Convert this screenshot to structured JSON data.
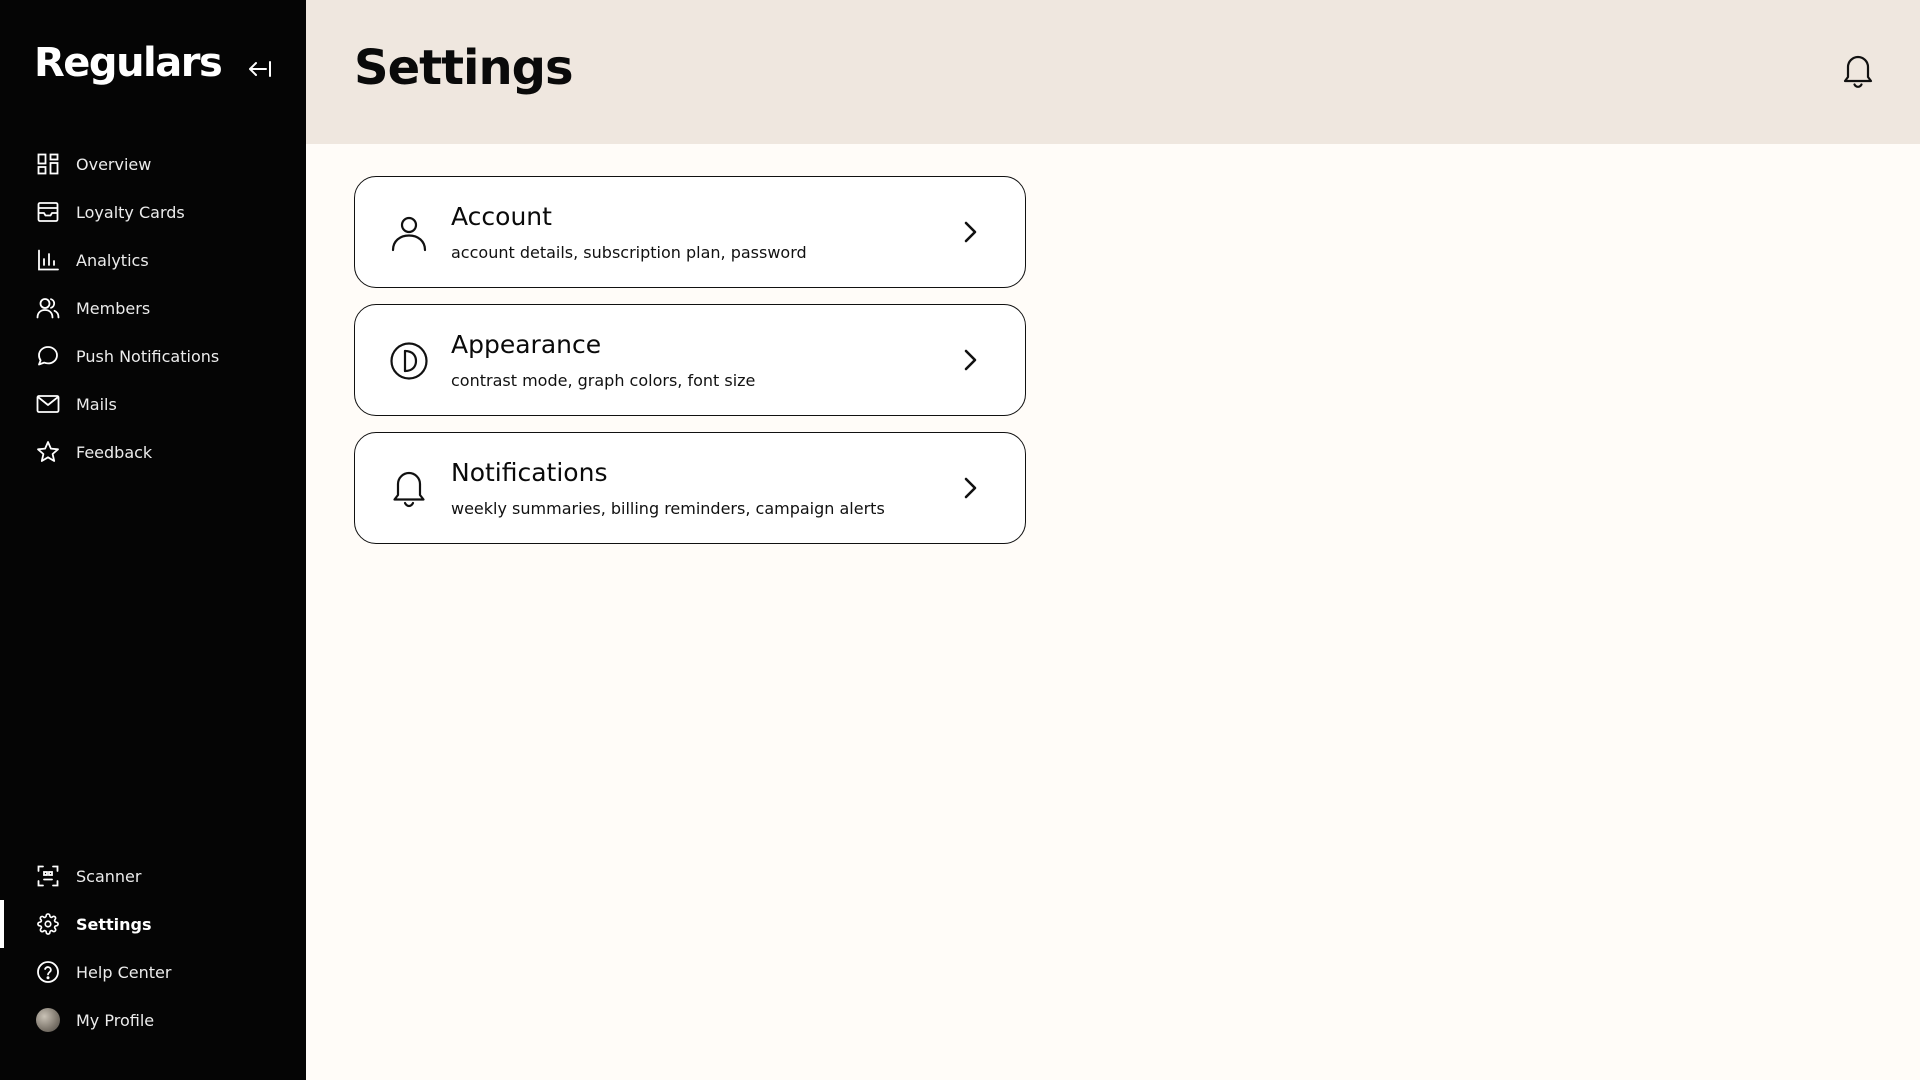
{
  "app": {
    "brand": "Regulars"
  },
  "sidebar": {
    "top_items": [
      {
        "label": "Overview",
        "icon": "overview-icon"
      },
      {
        "label": "Loyalty Cards",
        "icon": "loyalty-cards-icon"
      },
      {
        "label": "Analytics",
        "icon": "analytics-icon"
      },
      {
        "label": "Members",
        "icon": "members-icon"
      },
      {
        "label": "Push Notifications",
        "icon": "chat-bubble-icon"
      },
      {
        "label": "Mails",
        "icon": "mail-icon"
      },
      {
        "label": "Feedback",
        "icon": "star-icon"
      }
    ],
    "bottom_items": [
      {
        "label": "Scanner",
        "icon": "scanner-icon"
      },
      {
        "label": "Settings",
        "icon": "gear-icon",
        "active": true
      },
      {
        "label": "Help Center",
        "icon": "help-icon"
      },
      {
        "label": "My Profile",
        "icon": "avatar"
      }
    ]
  },
  "header": {
    "title": "Settings"
  },
  "cards": [
    {
      "title": "Account",
      "subtitle": "account details, subscription plan, password",
      "icon": "user-icon"
    },
    {
      "title": "Appearance",
      "subtitle": "contrast mode, graph colors, font size",
      "icon": "appearance-icon"
    },
    {
      "title": "Notifications",
      "subtitle": "weekly summaries, billing reminders, campaign alerts",
      "icon": "bell-icon"
    }
  ],
  "colors": {
    "sidebar_bg": "#050505",
    "header_bg": "#efe7df",
    "main_bg": "#fffcf8"
  }
}
